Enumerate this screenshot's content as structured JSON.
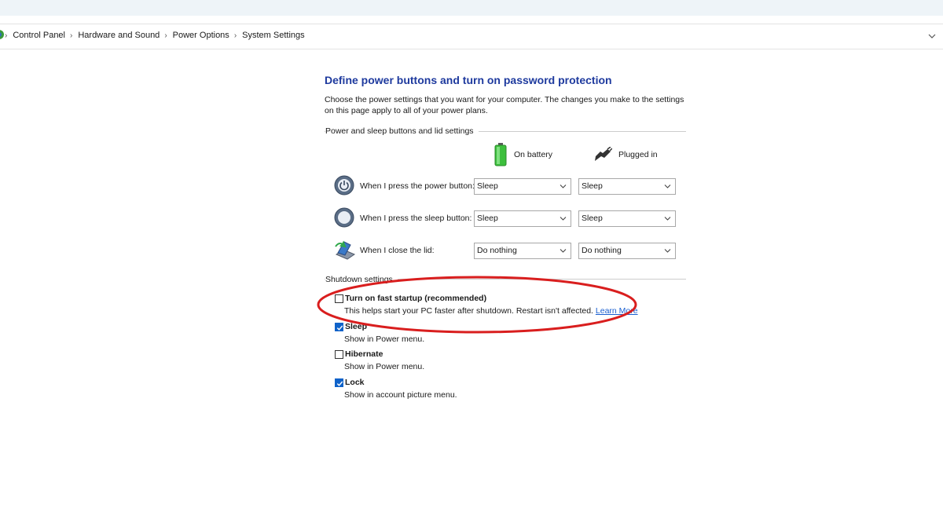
{
  "breadcrumb": {
    "items": [
      "Control Panel",
      "Hardware and Sound",
      "Power Options",
      "System Settings"
    ]
  },
  "page": {
    "title": "Define power buttons and turn on password protection",
    "description": "Choose the power settings that you want for your computer. The changes you make to the settings on this page apply to all of your power plans."
  },
  "power_section": {
    "label": "Power and sleep buttons and lid settings",
    "columns": {
      "battery": "On battery",
      "plugged": "Plugged in"
    },
    "rows": [
      {
        "label": "When I press the power button:",
        "battery": "Sleep",
        "plugged": "Sleep",
        "icon": "power-button-icon"
      },
      {
        "label": "When I press the sleep button:",
        "battery": "Sleep",
        "plugged": "Sleep",
        "icon": "sleep-button-icon"
      },
      {
        "label": "When I close the lid:",
        "battery": "Do nothing",
        "plugged": "Do nothing",
        "icon": "laptop-lid-icon"
      }
    ]
  },
  "shutdown_section": {
    "label": "Shutdown settings",
    "options": [
      {
        "title": "Turn on fast startup (recommended)",
        "desc": "This helps start your PC faster after shutdown. Restart isn't affected.",
        "link": "Learn More",
        "checked": false
      },
      {
        "title": "Sleep",
        "desc": "Show in Power menu.",
        "checked": true
      },
      {
        "title": "Hibernate",
        "desc": "Show in Power menu.",
        "checked": false
      },
      {
        "title": "Lock",
        "desc": "Show in account picture menu.",
        "checked": true
      }
    ]
  },
  "colors": {
    "title": "#1e3a9e",
    "link": "#1a5fd0",
    "checkbox_checked": "#0f62c9",
    "annotation": "#d91e1e"
  }
}
